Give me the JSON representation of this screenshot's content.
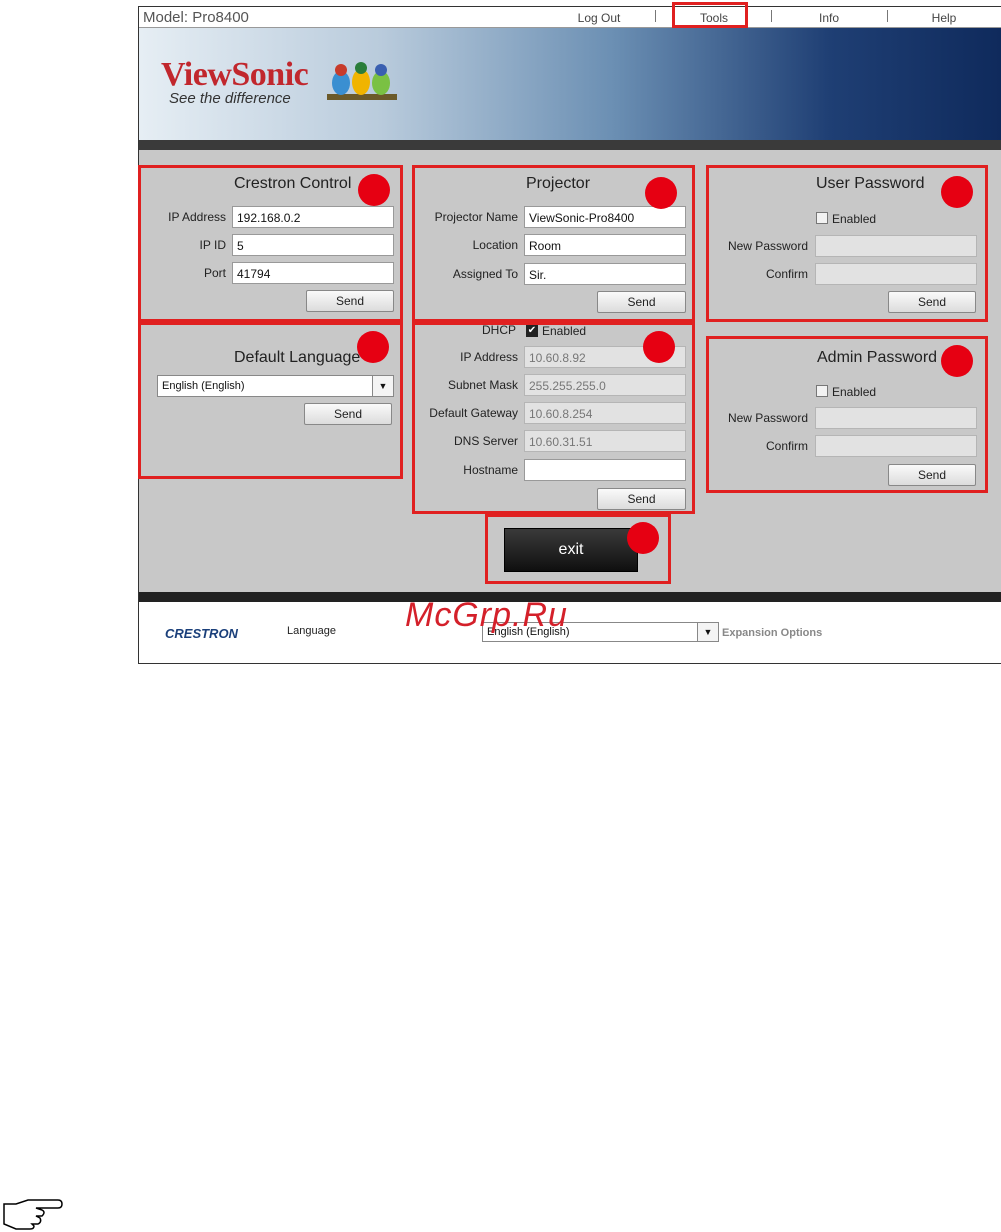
{
  "header": {
    "model": "Model: Pro8400",
    "nav": [
      "Log Out",
      "Tools",
      "Info",
      "Help"
    ]
  },
  "banner": {
    "brand": "ViewSonic",
    "slogan": "See the difference"
  },
  "crestron_control": {
    "title": "Crestron Control",
    "ip_address_label": "IP Address",
    "ip_address": "192.168.0.2",
    "ip_id_label": "IP ID",
    "ip_id": "5",
    "port_label": "Port",
    "port": "41794",
    "send": "Send"
  },
  "projector": {
    "title": "Projector",
    "name_label": "Projector Name",
    "name": "ViewSonic-Pro8400",
    "location_label": "Location",
    "location": "Room",
    "assigned_label": "Assigned To",
    "assigned": "Sir.",
    "send": "Send"
  },
  "user_password": {
    "title": "User Password",
    "enabled": "Enabled",
    "new_label": "New Password",
    "confirm_label": "Confirm",
    "send": "Send"
  },
  "default_language": {
    "title": "Default Language",
    "selected": "English (English)",
    "send": "Send"
  },
  "network": {
    "dhcp_label": "DHCP",
    "dhcp_enabled": "Enabled",
    "ip_label": "IP Address",
    "ip": "10.60.8.92",
    "subnet_label": "Subnet Mask",
    "subnet": "255.255.255.0",
    "gateway_label": "Default Gateway",
    "gateway": "10.60.8.254",
    "dns_label": "DNS Server",
    "dns": "10.60.31.51",
    "hostname_label": "Hostname",
    "hostname": "",
    "send": "Send"
  },
  "admin_password": {
    "title": "Admin Password",
    "enabled": "Enabled",
    "new_label": "New Password",
    "confirm_label": "Confirm",
    "send": "Send"
  },
  "exit": "exit",
  "footer": {
    "logo": "CRESTRON",
    "language_label": "Language",
    "language_value": "English (English)",
    "expansion": "Expansion Options"
  },
  "watermark": "McGrp.Ru",
  "colors": {
    "highlight": "#e02020",
    "marker": "#e60012",
    "brand": "#c1272d"
  }
}
